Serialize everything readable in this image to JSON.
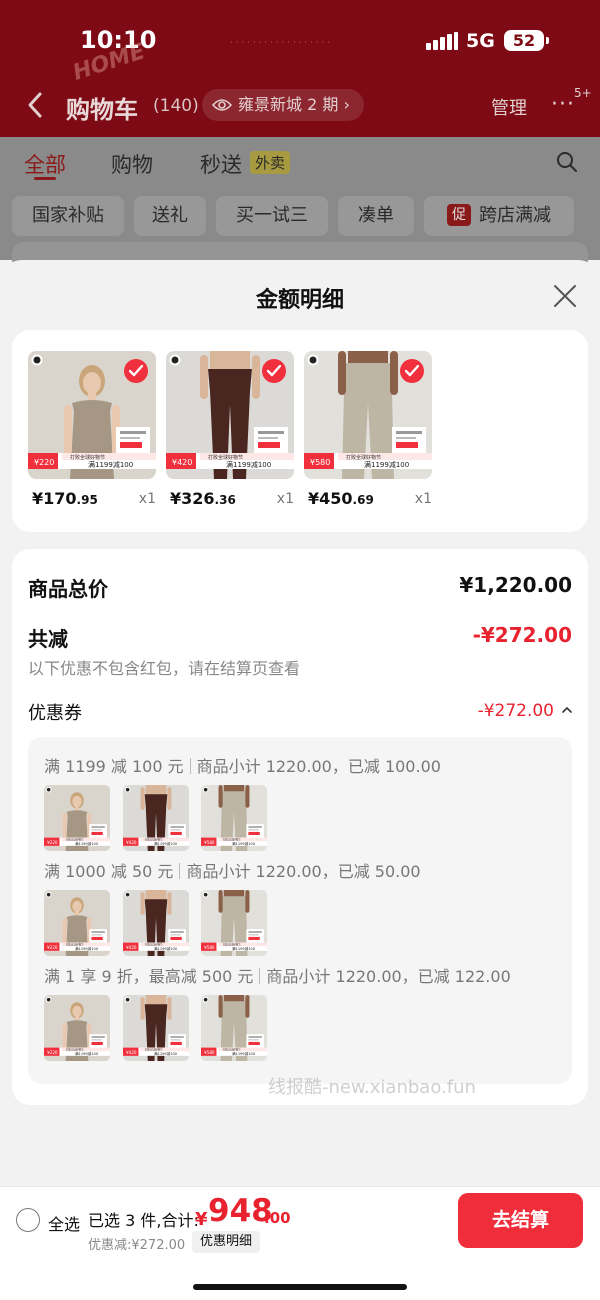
{
  "status": {
    "time": "10:10",
    "network": "5G",
    "battery": "52"
  },
  "header": {
    "title": "购物车",
    "count": "(140)",
    "location": "雍景新城 2 期",
    "manage": "管理",
    "more": "···",
    "more_badge": "5+"
  },
  "tabs": [
    {
      "label": "全部",
      "active": true
    },
    {
      "label": "购物"
    },
    {
      "label": "秒送"
    }
  ],
  "tab_badge": "外卖",
  "filters": [
    "国家补贴",
    "送礼",
    "买一试三",
    "凑单",
    "跨店满减"
  ],
  "filter_badge": "促",
  "sheet": {
    "title": "金额明细",
    "products": [
      {
        "price_int": "¥170",
        "price_dec": ".95",
        "qty": "x1",
        "img_price": "220",
        "color": "tan"
      },
      {
        "price_int": "¥326",
        "price_dec": ".36",
        "qty": "x1",
        "img_price": "420",
        "color": "brown"
      },
      {
        "price_int": "¥450",
        "price_dec": ".69",
        "qty": "x1",
        "img_price": "580",
        "color": "sage"
      }
    ],
    "img_banner": "满1199减100",
    "img_promo": "打败全球好物节",
    "total_label": "商品总价",
    "total_value": "¥1,220.00",
    "reduce_label": "共减",
    "reduce_value": "-¥272.00",
    "reduce_note": "以下优惠不包含红包，请在结算页查看",
    "coupon_label": "优惠券",
    "coupon_value": "-¥272.00",
    "coupons": [
      {
        "rule": "满 1199 减 100 元",
        "detail": "商品小计 1220.00，已减 100.00"
      },
      {
        "rule": "满 1000 减 50 元",
        "detail": "商品小计 1220.00，已减 50.00"
      },
      {
        "rule": "满 1 享 9 折，最高减 500 元",
        "detail": "商品小计 1220.00，已减 122.00"
      }
    ],
    "watermark": "线报酷-new.xianbao.fun"
  },
  "bottom": {
    "select_all": "全选",
    "selected": "已选 3 件,合计:",
    "currency": "¥",
    "sum_int": "948",
    "sum_dec": ".00",
    "discount": "优惠减:¥272.00",
    "detail_btn": "优惠明细",
    "checkout": "去结算"
  },
  "colors": {
    "accent": "#ef2d3b",
    "header_bg": "#7d0a14",
    "price_red": "#e8232f"
  }
}
